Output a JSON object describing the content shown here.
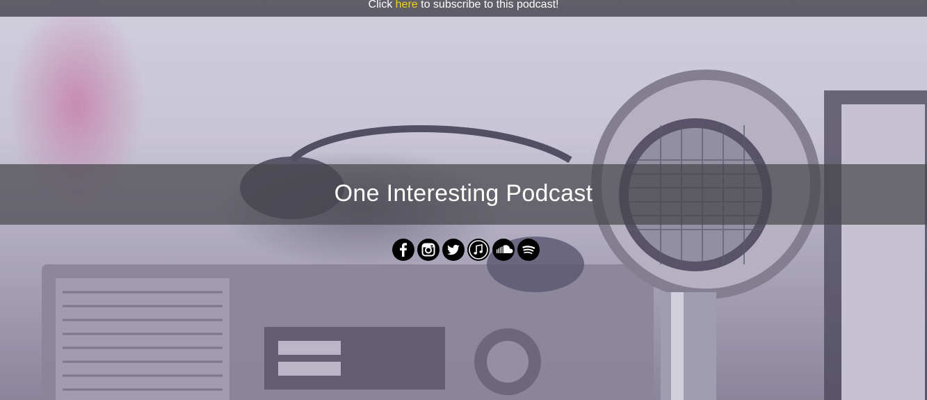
{
  "banner": {
    "prefix": "Click",
    "link_text": "here",
    "suffix": "to subscribe to this podcast!",
    "link_color": "#f0d21e"
  },
  "hero": {
    "title": "One Interesting Podcast"
  },
  "social": [
    {
      "icon": "facebook-icon"
    },
    {
      "icon": "instagram-icon"
    },
    {
      "icon": "twitter-icon"
    },
    {
      "icon": "apple-music-icon"
    },
    {
      "icon": "soundcloud-icon"
    },
    {
      "icon": "spotify-icon"
    }
  ]
}
